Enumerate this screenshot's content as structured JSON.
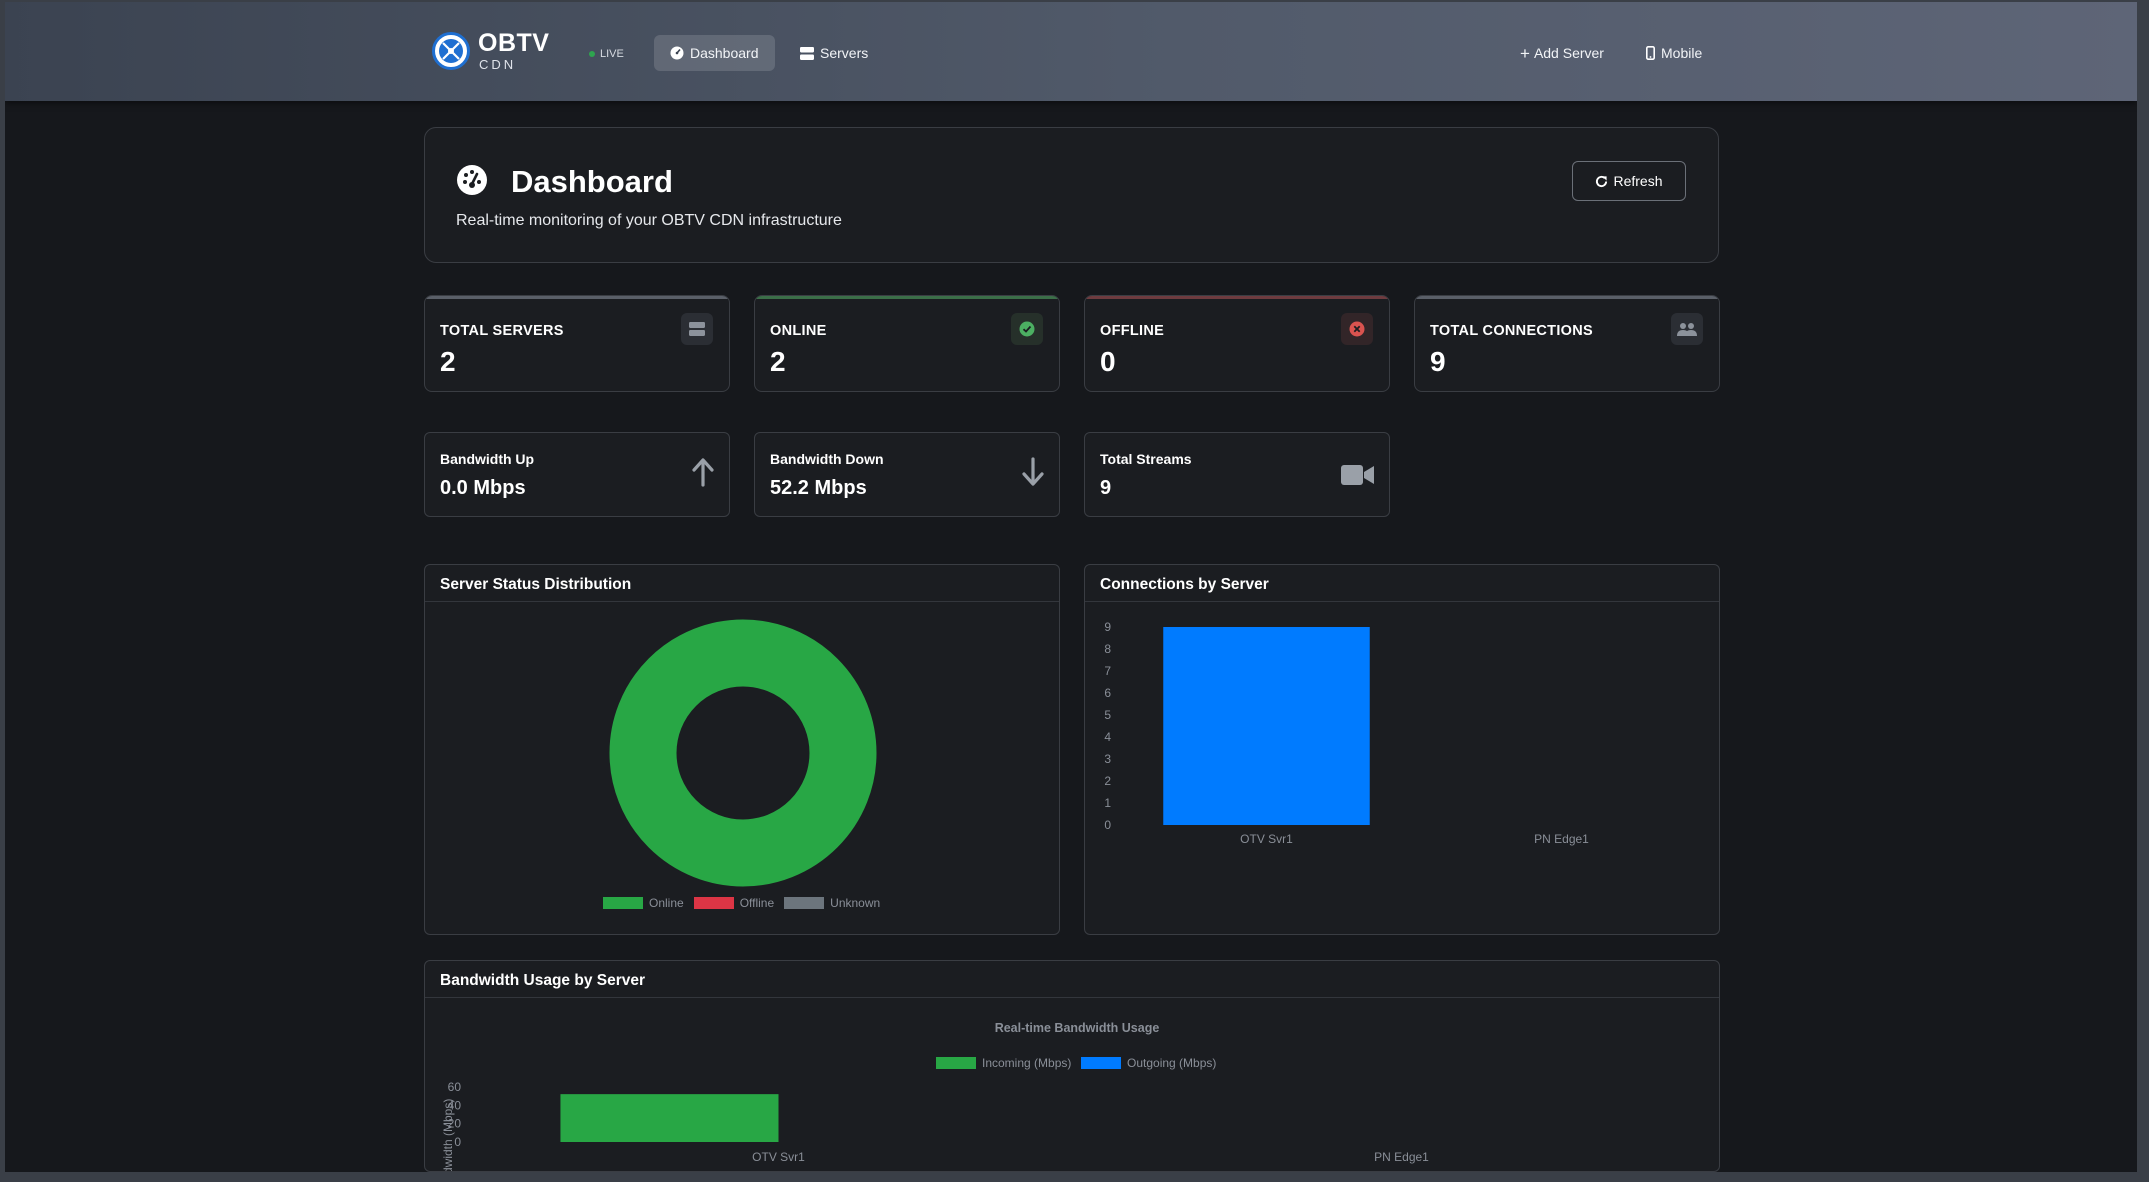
{
  "navbar": {
    "brand_title": "OBTV",
    "brand_sub": "CDN",
    "live_label": "LIVE",
    "dashboard_label": "Dashboard",
    "servers_label": "Servers",
    "add_server_label": "Add Server",
    "mobile_label": "Mobile"
  },
  "header": {
    "title": "Dashboard",
    "subtitle": "Real-time monitoring of your OBTV CDN infrastructure",
    "refresh_label": "Refresh"
  },
  "stats": [
    {
      "label": "TOTAL SERVERS",
      "value": "2",
      "icon": "server-icon",
      "accent": "#6c757d"
    },
    {
      "label": "ONLINE",
      "value": "2",
      "icon": "check-circle-icon",
      "accent": "#28a745"
    },
    {
      "label": "OFFLINE",
      "value": "0",
      "icon": "x-circle-icon",
      "accent": "#dc3545"
    },
    {
      "label": "TOTAL CONNECTIONS",
      "value": "9",
      "icon": "users-icon",
      "accent": "#6c757d"
    }
  ],
  "bandwidth": [
    {
      "label": "Bandwidth Up",
      "value": "0.0 Mbps",
      "icon": "arrow-up-icon"
    },
    {
      "label": "Bandwidth Down",
      "value": "52.2 Mbps",
      "icon": "arrow-down-icon"
    },
    {
      "label": "Total Streams",
      "value": "9",
      "icon": "video-camera-icon"
    }
  ],
  "colors": {
    "online": "#28a745",
    "offline": "#dc3545",
    "unknown": "#6c757d",
    "incoming": "#28a745",
    "outgoing": "#007bff"
  },
  "charts": {
    "status_title": "Server Status Distribution",
    "connections_title": "Connections by Server",
    "bandwidth_title": "Bandwidth Usage by Server"
  },
  "chart_data": [
    {
      "type": "pie",
      "title": "",
      "categories": [
        "Online",
        "Offline",
        "Unknown"
      ],
      "values": [
        2,
        0,
        0
      ],
      "legend": "bottom"
    },
    {
      "type": "bar",
      "title": "",
      "categories": [
        "OTV Svr1",
        "PN  Edge1"
      ],
      "values": [
        9,
        0
      ],
      "ylim": [
        0,
        9
      ],
      "yticks": [
        "0",
        "1",
        "2",
        "3",
        "4",
        "5",
        "6",
        "7",
        "8",
        "9"
      ],
      "grid": false
    },
    {
      "type": "bar",
      "title": "Real-time Bandwidth Usage",
      "ylabel": "Bandwidth (Mbps)",
      "categories": [
        "OTV Svr1",
        "PN  Edge1"
      ],
      "series": [
        {
          "name": "Incoming (Mbps)",
          "values": [
            52.2,
            0
          ]
        },
        {
          "name": "Outgoing (Mbps)",
          "values": [
            0,
            0
          ]
        }
      ],
      "ylim": [
        0,
        60
      ],
      "yticks": [
        "0",
        "20",
        "40",
        "60"
      ],
      "legend": "top"
    }
  ]
}
